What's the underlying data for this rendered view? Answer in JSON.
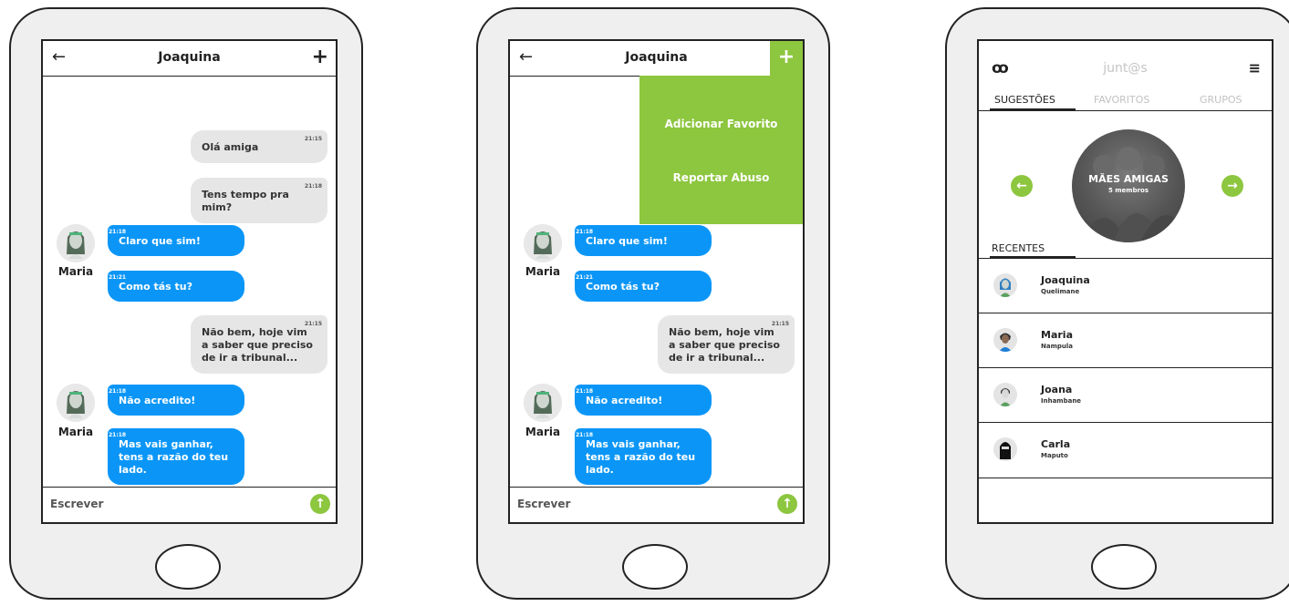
{
  "chat": {
    "title": "Joaquina",
    "back_icon": "←",
    "plus_icon": "+",
    "messages": [
      {
        "time": "21:15",
        "text": "Olá amiga"
      },
      {
        "time": "21:18",
        "text": "Tens tempo pra mim?"
      },
      {
        "time": "21:18",
        "text": "Claro que sim!"
      },
      {
        "time": "21:21",
        "text": "Como tás tu?"
      },
      {
        "time": "21:15",
        "text": "Não bem, hoje vim a saber que preciso de ir a tribunal..."
      },
      {
        "time": "21:18",
        "text": "Não acredito!"
      },
      {
        "time": "21:18",
        "text": "Mas vais ganhar, tens a razão do teu lado."
      }
    ],
    "sender_name": "Maria",
    "composer_placeholder": "Escrever",
    "send_icon": "↑",
    "menu": {
      "add_favorite": "Adicionar Favorito",
      "report_abuse": "Reportar Abuso"
    }
  },
  "home": {
    "logo": "ꝏ",
    "app_title": "junt@s",
    "menu_icon": "≡",
    "tabs": [
      "SUGESTÕES",
      "FAVORITOS",
      "GRUPOS"
    ],
    "group": {
      "title": "MÃES AMIGAS",
      "subtitle": "5 membros"
    },
    "prev_icon": "←",
    "next_icon": "→",
    "recent_label": "RECENTES",
    "contacts": [
      {
        "name": "Joaquina",
        "city": "Quelimane"
      },
      {
        "name": "Maria",
        "city": "Nampula"
      },
      {
        "name": "Joana",
        "city": "Inhambane"
      },
      {
        "name": "Carla",
        "city": "Maputo"
      }
    ]
  },
  "colors": {
    "accent": "#8dc63f",
    "bubble_in": "#0b96f7",
    "bubble_out": "#e6e6e6"
  }
}
